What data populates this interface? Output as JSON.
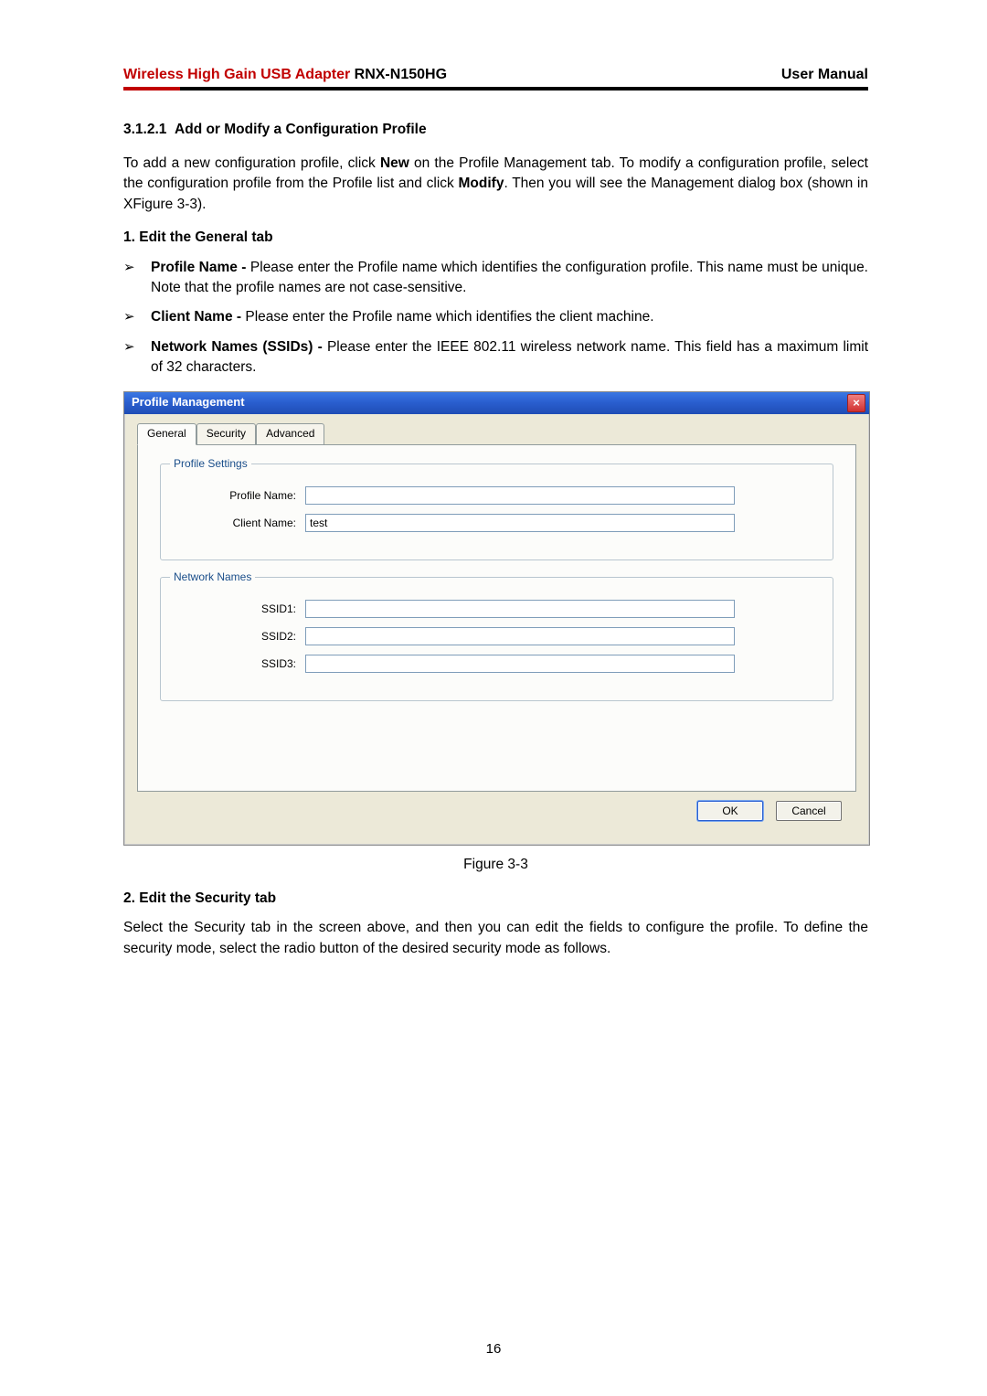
{
  "header": {
    "title_red": "Wireless High Gain USB Adapter",
    "title_model": " RNX-N150HG",
    "right": "User Manual"
  },
  "section_number": "3.1.2.1",
  "section_title": "Add or Modify a Configuration Profile",
  "intro_a": "To add a new configuration profile, click ",
  "intro_new": "New",
  "intro_b": " on the Profile Management tab. To modify a configuration profile, select the configuration profile from the Profile list and click ",
  "intro_modify": "Modify",
  "intro_c": ". Then you will see the Management dialog box (shown in XFigure 3-3).",
  "step1_label": "1.   Edit the General tab",
  "bullets": [
    {
      "bold": "Profile Name - ",
      "rest": "Please enter the Profile name which identifies the configuration profile. This name must be unique. Note that the profile names are not case-sensitive."
    },
    {
      "bold": "Client Name - ",
      "rest": "Please enter the Profile name which identifies the client machine."
    },
    {
      "bold": "Network Names (SSIDs) - ",
      "rest": "Please enter the IEEE 802.11 wireless network name. This field has a maximum limit of 32 characters."
    }
  ],
  "chevron": "➢",
  "dialog": {
    "title": "Profile Management",
    "tabs": [
      "General",
      "Security",
      "Advanced"
    ],
    "groups": {
      "profile": {
        "legend": "Profile Settings",
        "fields": [
          {
            "label": "Profile Name:",
            "value": ""
          },
          {
            "label": "Client Name:",
            "value": "test"
          }
        ]
      },
      "network": {
        "legend": "Network Names",
        "fields": [
          {
            "label": "SSID1:",
            "value": ""
          },
          {
            "label": "SSID2:",
            "value": ""
          },
          {
            "label": "SSID3:",
            "value": ""
          }
        ]
      }
    },
    "ok": "OK",
    "cancel": "Cancel"
  },
  "figure_caption": "Figure 3-3",
  "step2_label": "2.   Edit the Security tab",
  "security_para": "Select the Security tab in the screen above, and then you can edit the fields to configure the profile. To define the security mode, select the radio button of the desired security mode as follows.",
  "page_number": "16"
}
